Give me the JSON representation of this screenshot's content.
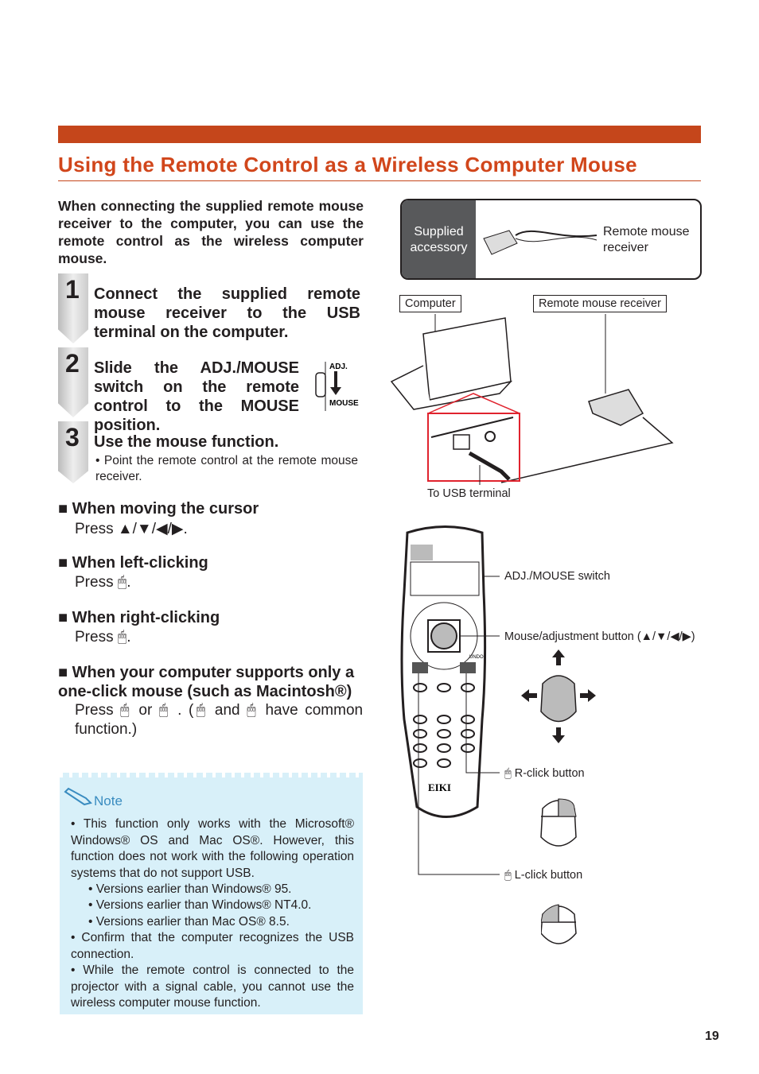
{
  "header": {
    "title": "Using the Remote Control as a Wireless Computer Mouse",
    "accent": "#c5461b"
  },
  "intro": "When connecting the supplied remote mouse receiver to the computer, you can use the remote control as the wireless computer mouse.",
  "steps": [
    {
      "num": "1",
      "text": "Connect the supplied remote mouse receiver to the USB terminal on the computer."
    },
    {
      "num": "2",
      "text": "Slide the ADJ./MOUSE switch on the remote control to the MOUSE position.",
      "switch_top": "ADJ.",
      "switch_bottom": "MOUSE"
    },
    {
      "num": "3",
      "text": "Use the mouse function.",
      "sub": "• Point the remote control at the remote mouse receiver."
    }
  ],
  "sections": [
    {
      "heading": "■ When moving the cursor",
      "text": "Press ▲/▼/◀/▶."
    },
    {
      "heading": "■ When left-clicking",
      "text": "Press",
      "end": "."
    },
    {
      "heading": "■ When right-clicking",
      "text": "Press",
      "end": "."
    },
    {
      "heading": "■ When your computer supports only a one-click mouse (such as Macintosh®)",
      "t1": "Press",
      "t2": "or",
      "t3": ". (",
      "t4": "and",
      "t5": "have common function.)"
    }
  ],
  "note": {
    "title": "Note",
    "items": [
      "• This function only works with the Microsoft® Windows® OS and Mac OS®. However, this function does not work with the following operation systems that do not support USB.",
      "• Versions earlier than Windows® 95.",
      "• Versions earlier than Windows® NT4.0.",
      "• Versions earlier than Mac OS® 8.5.",
      "• Confirm that the computer recognizes the USB connection.",
      "• While the remote control is connected to the projector with a signal cable, you cannot use the wireless computer mouse function."
    ]
  },
  "accessory": {
    "label": "Supplied accessory",
    "item": "Remote mouse receiver"
  },
  "diagram": {
    "computer": "Computer",
    "receiver": "Remote mouse receiver",
    "usb": "To USB terminal"
  },
  "remote": {
    "switch": "ADJ./MOUSE switch",
    "mouse_button": "Mouse/adjustment button (▲/▼/◀/▶)",
    "rclick": "R-click button",
    "lclick": "L-click button",
    "brand": "EIKI",
    "undo": "UNDO"
  },
  "page_number": "19"
}
